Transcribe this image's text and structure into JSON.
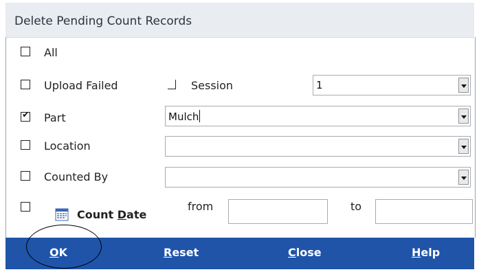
{
  "dialog": {
    "title": "Delete Pending Count Records"
  },
  "options": {
    "all": {
      "label": "All",
      "checked": false
    },
    "upload_failed": {
      "label": "Upload Failed",
      "checked": false
    },
    "session": {
      "label": "Session",
      "value": "1"
    },
    "part": {
      "label": "Part",
      "checked": true,
      "value": "Mulch"
    },
    "location": {
      "label": "Location",
      "checked": false,
      "value": ""
    },
    "counted_by": {
      "label": "Counted By",
      "checked": false,
      "value": ""
    },
    "count_date": {
      "label_pre": "Count ",
      "label_ul": "D",
      "label_post": "ate",
      "checked": false,
      "from_label": "from",
      "to_label": "to",
      "from_value": "",
      "to_value": ""
    }
  },
  "buttons": {
    "ok": {
      "mnemonic": "O",
      "rest": "K"
    },
    "reset": {
      "mnemonic": "R",
      "rest": "eset"
    },
    "close": {
      "mnemonic": "C",
      "rest": "lose"
    },
    "help": {
      "mnemonic": "H",
      "rest": "elp"
    }
  },
  "colors": {
    "button_bar": "#1f54a9",
    "title_bar": "#e9ecf0"
  }
}
